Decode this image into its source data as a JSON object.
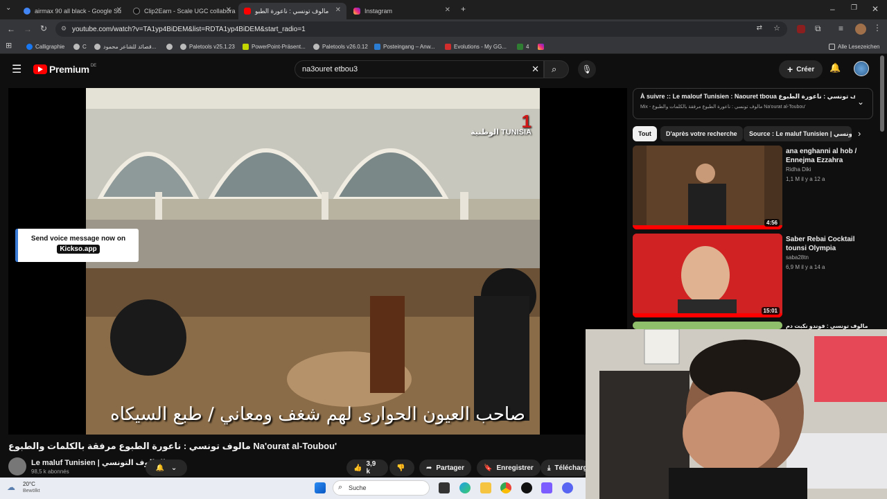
{
  "browser": {
    "tabs": [
      {
        "label": "airmax 90 all black - Google Su"
      },
      {
        "label": "Clip2Earn - Scale UGC collabora"
      },
      {
        "label": "مالوف تونسي : ناعورة الطبو"
      },
      {
        "label": "Instagram"
      }
    ],
    "url": "youtube.com/watch?v=TA1yp4BiDEM&list=RDTA1yp4BiDEM&start_radio=1",
    "bookmarks": [
      {
        "label": "Calligraphie"
      },
      {
        "label": "C"
      },
      {
        "label": "قصائد للشاعر محمود..."
      },
      {
        "label": "Paletools v25.1.23"
      },
      {
        "label": "PowerPoint-Präsent..."
      },
      {
        "label": "Paletools v26.0.12"
      },
      {
        "label": "Posteingang – Anw..."
      },
      {
        "label": "Evolutions - My GG..."
      },
      {
        "label": "4"
      }
    ],
    "all_bookmarks_label": "Alle Lesezeichen"
  },
  "youtube": {
    "logo_text": "Premium",
    "logo_region": "DE",
    "search_value": "na3ouret etbou3",
    "create_label": "Créer"
  },
  "video": {
    "subtitle": "صاحب العيون الحوارى لهم شغف ومعاني  /  طبع السيكاه",
    "channel_logo_text": "الوطنية TUNISIA",
    "channel_logo_number": "1",
    "title": "مالوف تونسي : ناعورة الطبوع مرفقة بالكلمات والطبوع Na'ourat al-Toubou'",
    "channel_name": "Le maluf Tunisien | المالوف التونسي",
    "subscribers": "98,5 k abonnés",
    "likes": "3,9 k",
    "share_label": "Partager",
    "save_label": "Enregistrer",
    "download_label": "Télécharger"
  },
  "overlay": {
    "line1": "Send voice message now on",
    "line2": "Kickso.app"
  },
  "playlist": {
    "title": "À suivre :: Le malouf Tunisien : Naouret tboua مالوف تونسي : ناعورة الطبوع",
    "subtitle": "Mix - مالوف تونسي : ناعورة الطبوع مرفقة بالكلمات والطبوع Na'ourat al-Toubou'"
  },
  "chips": [
    {
      "label": "Tout"
    },
    {
      "label": "D'après votre recherche"
    },
    {
      "label": "Source : Le maluf Tunisien | المالوف التونسي"
    }
  ],
  "recommendations": [
    {
      "title": "ana enghanni al hob / Ennejma Ezzahra",
      "channel": "Ridha Diki",
      "stats": "1,1 M  il y a 12 a",
      "duration": "4:56"
    },
    {
      "title": "Saber Rebai Cocktail tounsi Olympia",
      "channel": "saba28tn",
      "stats": "6,9 M  il y a 14 a",
      "duration": "15:01"
    },
    {
      "title": "مالوف تونسي : فوندو نكبت دم المحابل",
      "channel": "",
      "stats": "",
      "duration": ""
    }
  ],
  "taskbar": {
    "weather_temp": "20°C",
    "weather_desc": "Bewölkt",
    "search_placeholder": "Suche"
  },
  "colors": {
    "youtube_red": "#ff0000",
    "page_bg": "#0f0f0f",
    "chip_bg": "#272727"
  }
}
